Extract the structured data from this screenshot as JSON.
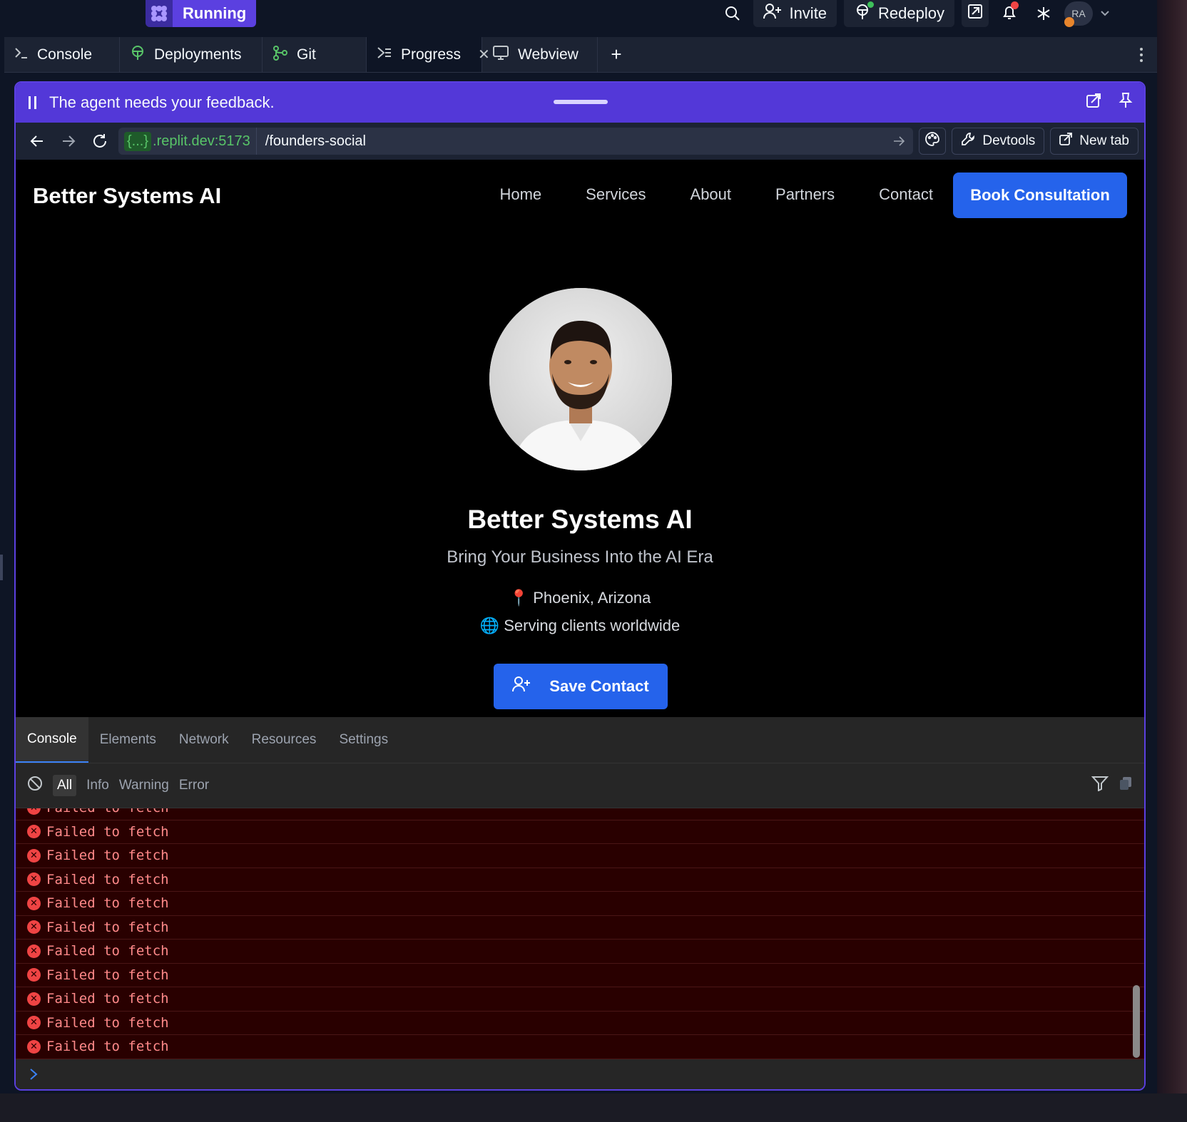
{
  "topbar": {
    "status_label": "Running",
    "invite_label": "Invite",
    "redeploy_label": "Redeploy",
    "avatar_initials": "RA"
  },
  "tabs": [
    {
      "label": "Console"
    },
    {
      "label": "Deployments"
    },
    {
      "label": "Git"
    },
    {
      "label": "Progress"
    },
    {
      "label": "Webview"
    }
  ],
  "feedback": {
    "message": "The agent needs your feedback."
  },
  "browser": {
    "host_brace": "{...}",
    "host_rest": ".replit.dev:5173",
    "path": "/founders-social",
    "devtools_label": "Devtools",
    "new_tab_label": "New tab"
  },
  "site": {
    "brand": "Better Systems AI",
    "nav": [
      "Home",
      "Services",
      "About",
      "Partners",
      "Contact"
    ],
    "cta": "Book Consultation",
    "hero_title": "Better Systems AI",
    "hero_subtitle": "Bring Your Business Into the AI Era",
    "location": "📍 Phoenix, Arizona",
    "worldwide": "🌐 Serving clients worldwide",
    "save_contact": "Save Contact"
  },
  "devtools": {
    "tabs": [
      "Console",
      "Elements",
      "Network",
      "Resources",
      "Settings"
    ],
    "filters": [
      "All",
      "Info",
      "Warning",
      "Error"
    ],
    "logs": [
      "Failed to fetch",
      "Failed to fetch",
      "Failed to fetch",
      "Failed to fetch",
      "Failed to fetch",
      "Failed to fetch",
      "Failed to fetch",
      "Failed to fetch",
      "Failed to fetch",
      "Failed to fetch",
      "Failed to fetch"
    ]
  },
  "colors": {
    "accent_purple": "#5b40e0",
    "brand_blue": "#2563eb",
    "error_red": "#ef4444",
    "host_green": "#58c468"
  }
}
